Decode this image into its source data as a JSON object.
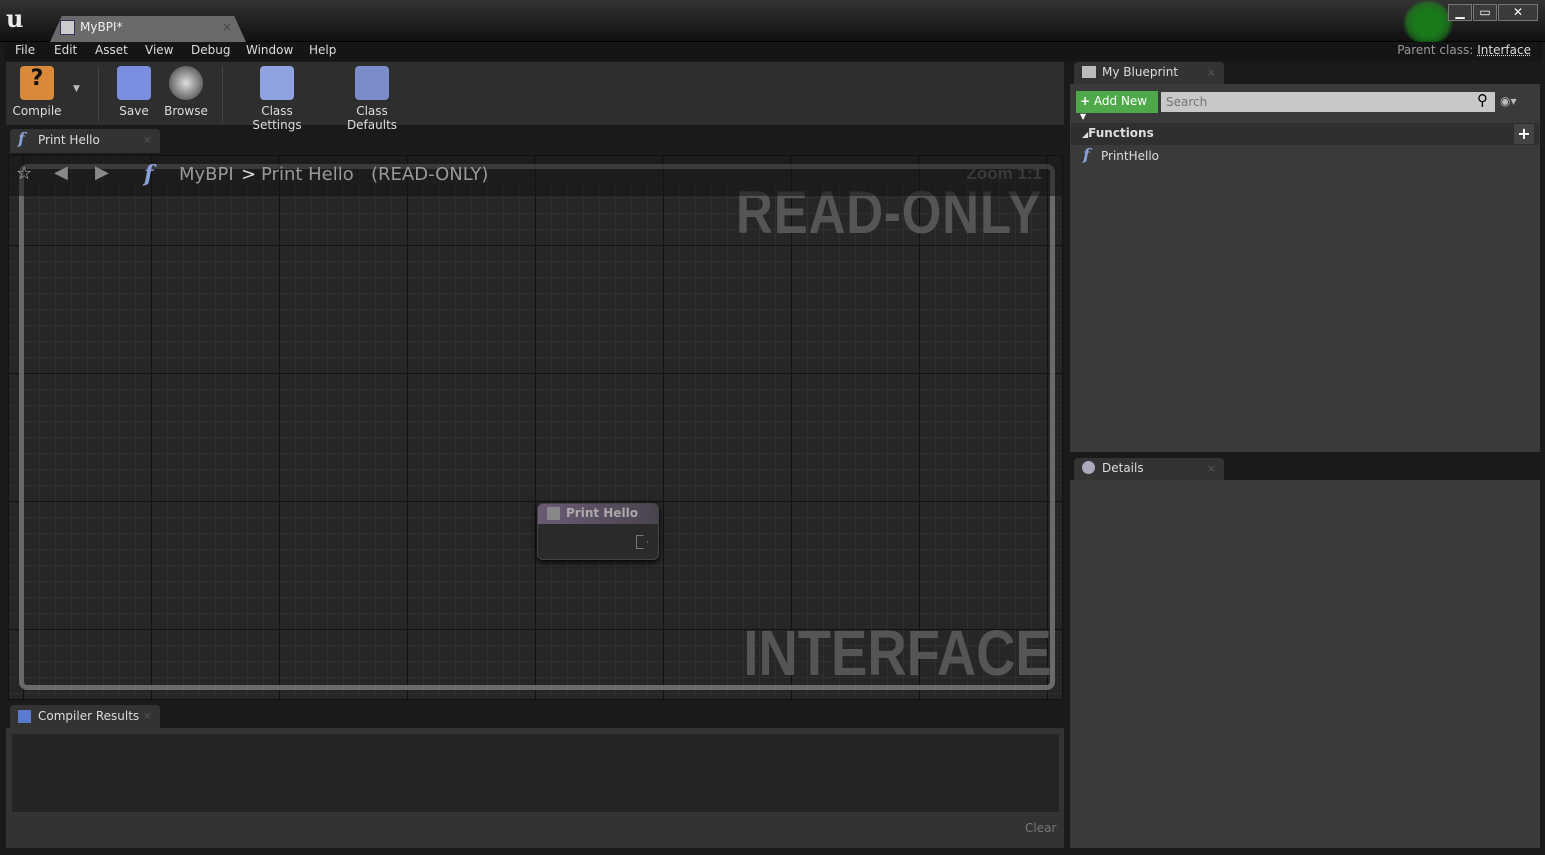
{
  "window": {
    "doc_tab": "MyBPI*",
    "min": "▁",
    "max": "▭",
    "close": "✕"
  },
  "menu": [
    "File",
    "Edit",
    "Asset",
    "View",
    "Debug",
    "Window",
    "Help"
  ],
  "parent_class": {
    "label": "Parent class:",
    "value": "Interface"
  },
  "toolbar": {
    "compile": "Compile",
    "save": "Save",
    "browse": "Browse",
    "class_settings": "Class Settings",
    "class_defaults": "Class Defaults"
  },
  "graph": {
    "tab": "Print Hello",
    "crumb_root": "MyBPI",
    "crumb_sep": ">",
    "crumb_leaf": "Print Hello",
    "crumb_state": "(READ-ONLY)",
    "zoom": "Zoom 1:1",
    "watermark_top": "READ-ONLY",
    "watermark_bottom": "INTERFACE",
    "node_title": "Print Hello"
  },
  "compiler": {
    "tab": "Compiler Results",
    "clear": "Clear"
  },
  "my_blueprint": {
    "tab": "My Blueprint",
    "add_new": "Add New",
    "search_placeholder": "Search",
    "functions_header": "Functions",
    "functions": [
      "PrintHello"
    ]
  },
  "details": {
    "tab": "Details"
  }
}
